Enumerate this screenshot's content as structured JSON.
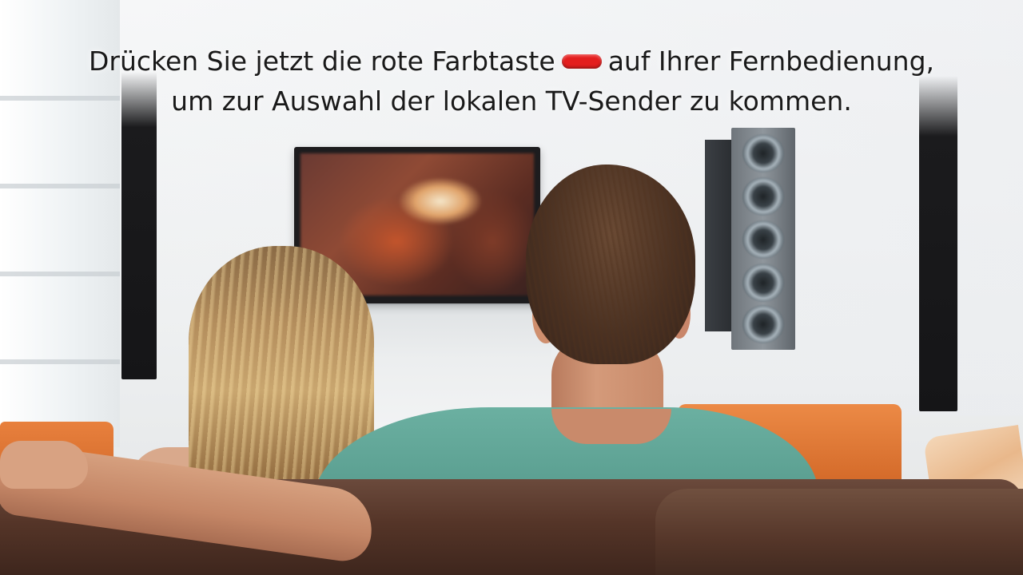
{
  "overlay": {
    "line1_before": "Drücken Sie jetzt die rote Farbtaste",
    "line1_after": "auf Ihrer Fernbedienung,",
    "line2": "um zur Auswahl der lokalen TV-Sender zu kommen.",
    "red_key_icon": "red-color-button-icon",
    "red_key_color": "#e31e1e"
  }
}
